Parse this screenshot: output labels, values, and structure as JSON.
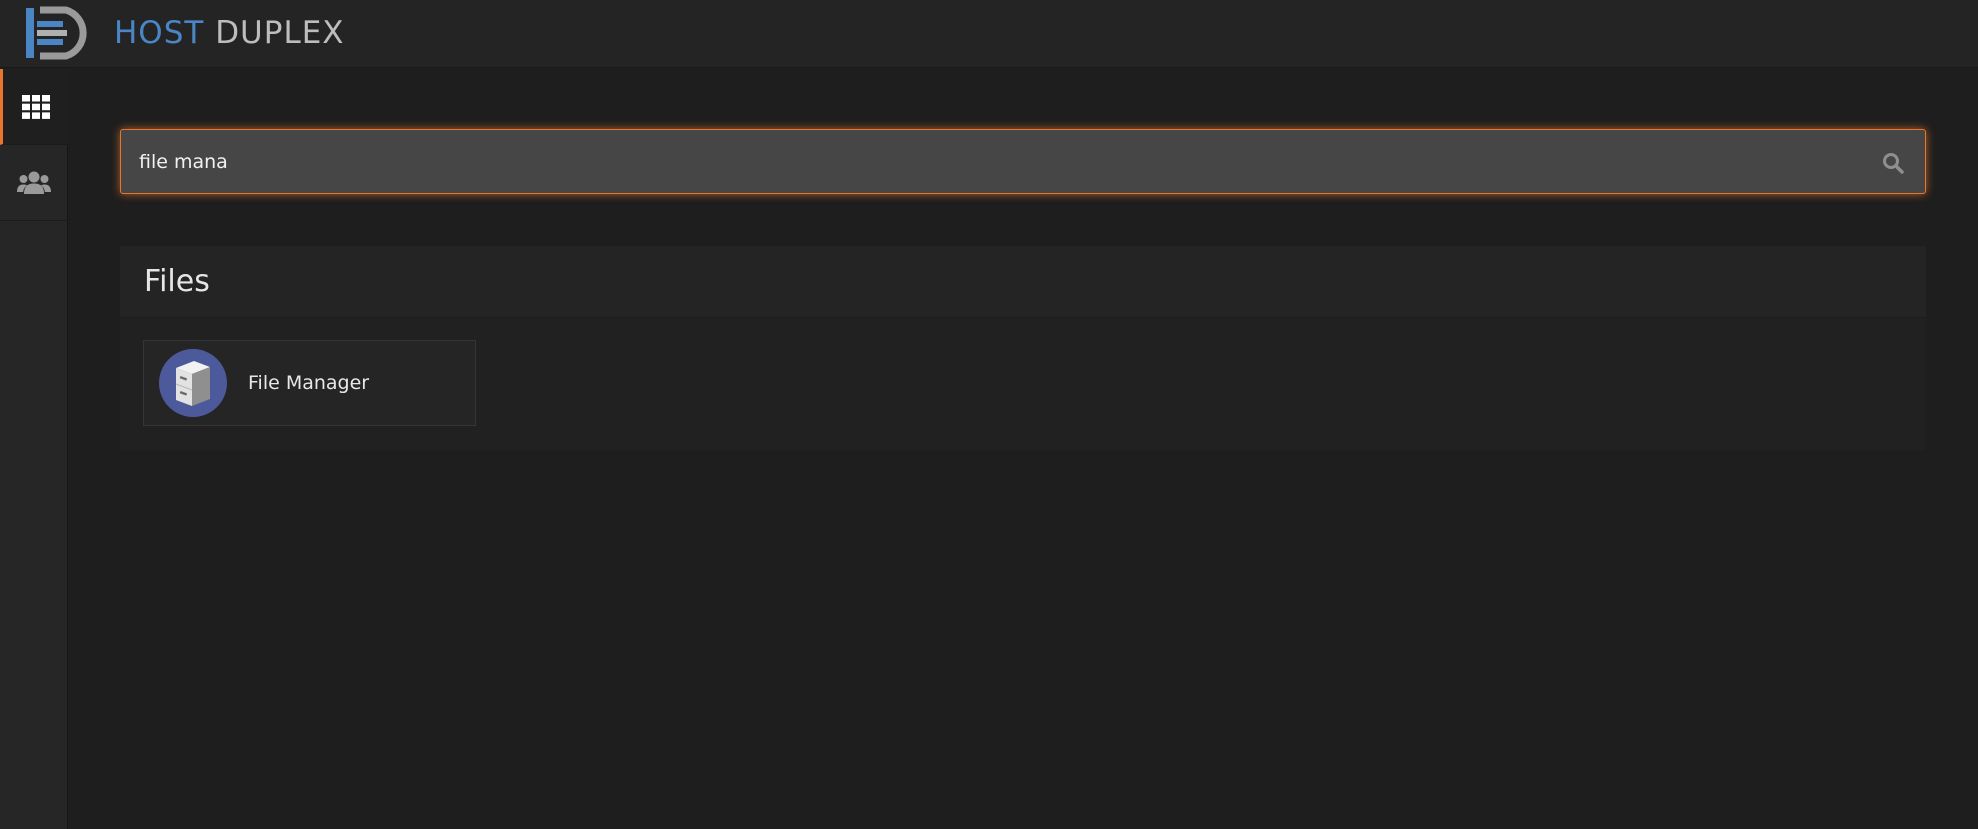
{
  "brand": {
    "word1": "HOST",
    "word2": "DUPLEX",
    "colors": {
      "host": "#4a86c5",
      "duplex": "#bdbdbd"
    }
  },
  "sidebar": {
    "items": [
      {
        "icon": "grid-icon",
        "active": true
      },
      {
        "icon": "users-icon",
        "active": false
      }
    ]
  },
  "search": {
    "value": "file mana",
    "icon": "search-icon"
  },
  "accent_color": "#e8752d",
  "results": {
    "section_title": "Files",
    "items": [
      {
        "label": "File Manager",
        "icon": "file-cabinet-icon"
      }
    ]
  }
}
